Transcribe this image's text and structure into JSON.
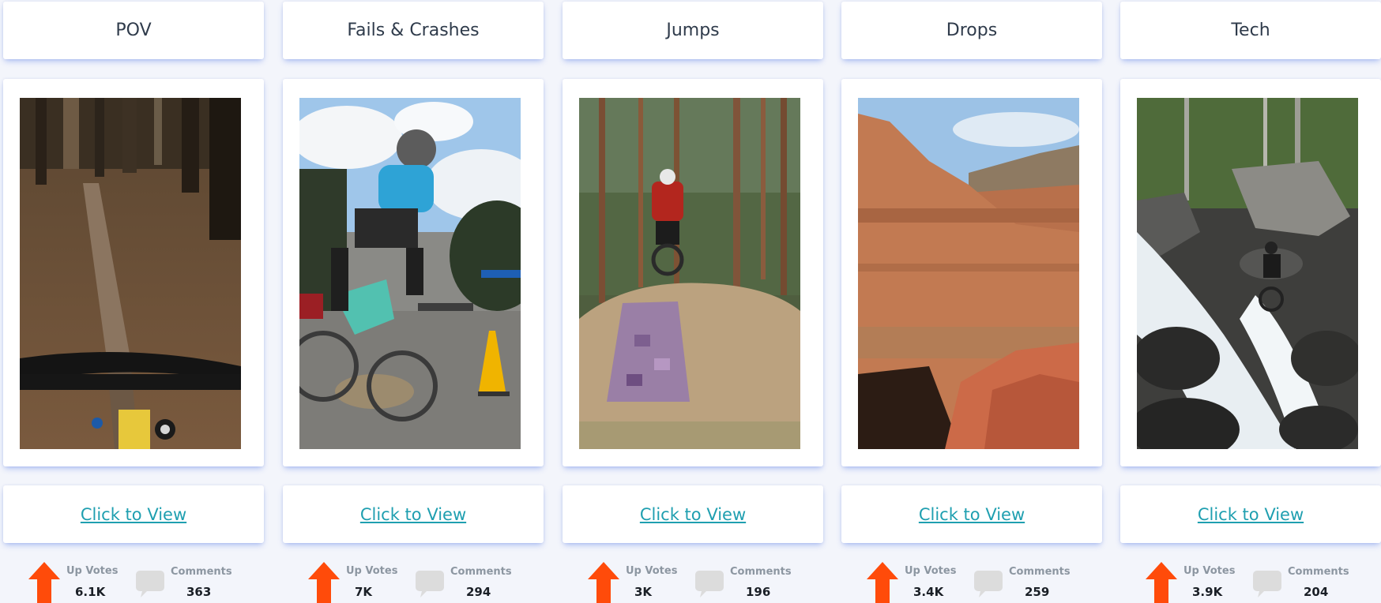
{
  "cards": [
    {
      "category": "POV",
      "link_label": "Click to View",
      "upvotes_label": "Up Votes",
      "upvotes": "6.1K",
      "comments_label": "Comments",
      "comments": "363"
    },
    {
      "category": "Fails & Crashes",
      "link_label": "Click to View",
      "upvotes_label": "Up Votes",
      "upvotes": "7K",
      "comments_label": "Comments",
      "comments": "294"
    },
    {
      "category": "Jumps",
      "link_label": "Click to View",
      "upvotes_label": "Up Votes",
      "upvotes": "3K",
      "comments_label": "Comments",
      "comments": "196"
    },
    {
      "category": "Drops",
      "link_label": "Click to View",
      "upvotes_label": "Up Votes",
      "upvotes": "3.4K",
      "comments_label": "Comments",
      "comments": "259"
    },
    {
      "category": "Tech",
      "link_label": "Click to View",
      "upvotes_label": "Up Votes",
      "upvotes": "3.9K",
      "comments_label": "Comments",
      "comments": "204"
    }
  ],
  "colors": {
    "link": "#1f9fb0",
    "upvote_arrow": "#ff4b0a",
    "comment_icon": "#dcdcdc",
    "card_shadow": "#466ee6"
  },
  "icons": {
    "upvote": "arrow-up-icon",
    "comments": "speech-bubble-icon"
  }
}
